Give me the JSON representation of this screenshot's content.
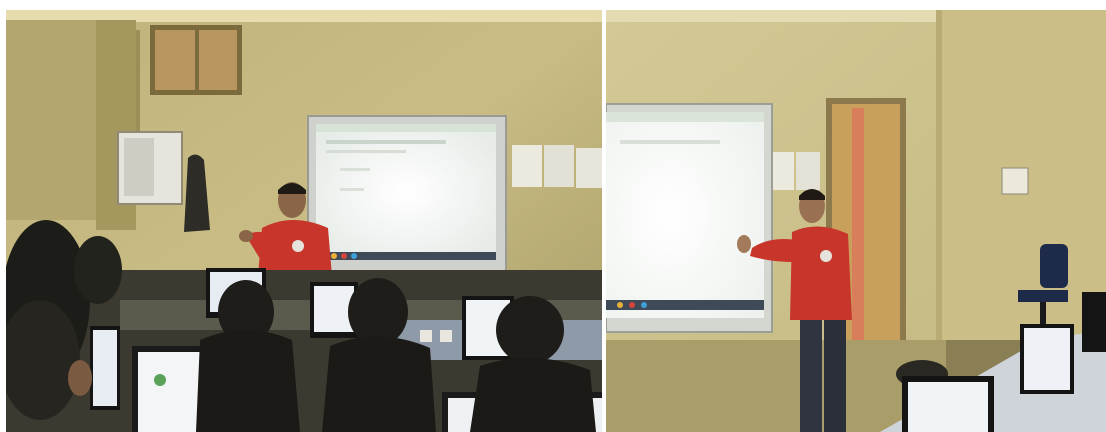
{
  "photos": [
    {
      "name": "left-photo",
      "description_tags": [
        "classroom",
        "projector-screen",
        "presenter",
        "monitors",
        "students"
      ]
    },
    {
      "name": "right-photo",
      "description_tags": [
        "classroom",
        "projector-screen",
        "presenter",
        "door",
        "chair",
        "monitors"
      ]
    }
  ],
  "colors": {
    "wall": "#cfc38a",
    "wall_dark": "#8f8450",
    "screen": "#f4f7f4",
    "hoodie": "#c8352b",
    "frame": "#d9dad6",
    "shadow": "#1c1c18",
    "door": "#c9a05b"
  }
}
